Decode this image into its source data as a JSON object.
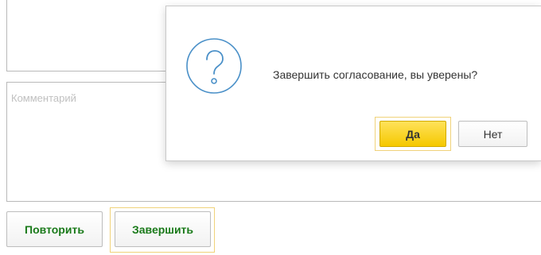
{
  "form": {
    "comment": {
      "placeholder": "Комментарий"
    },
    "buttons": {
      "repeat_label": "Повторить",
      "finish_label": "Завершить"
    }
  },
  "dialog": {
    "icon": "question-icon",
    "message": "Завершить согласование, вы уверены?",
    "yes_label": "Да",
    "no_label": "Нет"
  },
  "colors": {
    "accent_yellow": "#f5c800",
    "green_text": "#1a7a1a",
    "icon_blue": "#4a90c8"
  }
}
